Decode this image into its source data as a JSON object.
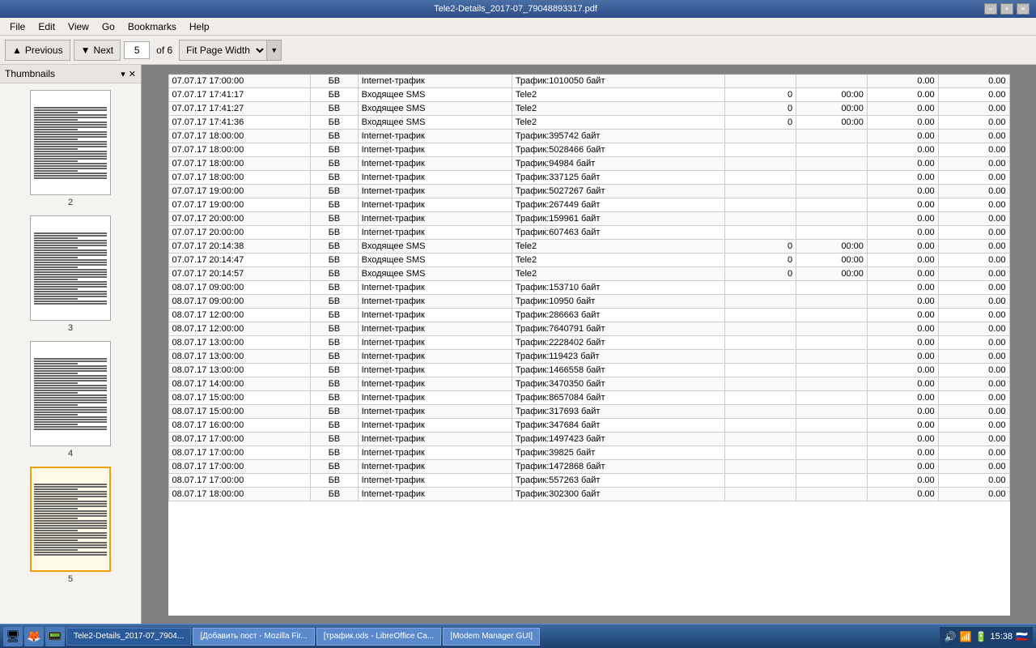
{
  "titlebar": {
    "title": "Tele2-Details_2017-07_79048893317.pdf",
    "min": "−",
    "max": "+",
    "close": "×"
  },
  "menubar": {
    "items": [
      "File",
      "Edit",
      "View",
      "Go",
      "Bookmarks",
      "Help"
    ]
  },
  "toolbar": {
    "previous_label": "Previous",
    "next_label": "Next",
    "current_page": "5",
    "total_pages": "of 6",
    "fit_option": "Fit Page Width"
  },
  "sidebar": {
    "title": "Thumbnails",
    "pages": [
      2,
      3,
      4,
      5
    ]
  },
  "table": {
    "rows": [
      [
        "07.07.17 17:41:17",
        "БВ",
        "Входящее SMS",
        "Tele2",
        "0",
        "00:00",
        "0.00",
        "0.00"
      ],
      [
        "07.07.17 17:41:27",
        "БВ",
        "Входящее SMS",
        "Tele2",
        "0",
        "00:00",
        "0.00",
        "0.00"
      ],
      [
        "07.07.17 17:41:36",
        "БВ",
        "Входящее SMS",
        "Tele2",
        "0",
        "00:00",
        "0.00",
        "0.00"
      ],
      [
        "07.07.17 18:00:00",
        "БВ",
        "Internet-трафик",
        "Трафик:395742 байт",
        "",
        "",
        "0.00",
        "0.00"
      ],
      [
        "07.07.17 18:00:00",
        "БВ",
        "Internet-трафик",
        "Трафик:5028466 байт",
        "",
        "",
        "0.00",
        "0.00"
      ],
      [
        "07.07.17 18:00:00",
        "БВ",
        "Internet-трафик",
        "Трафик:94984 байт",
        "",
        "",
        "0.00",
        "0.00"
      ],
      [
        "07.07.17 18:00:00",
        "БВ",
        "Internet-трафик",
        "Трафик:337125 байт",
        "",
        "",
        "0.00",
        "0.00"
      ],
      [
        "07.07.17 19:00:00",
        "БВ",
        "Internet-трафик",
        "Трафик:5027267 байт",
        "",
        "",
        "0.00",
        "0.00"
      ],
      [
        "07.07.17 19:00:00",
        "БВ",
        "Internet-трафик",
        "Трафик:267449 байт",
        "",
        "",
        "0.00",
        "0.00"
      ],
      [
        "07.07.17 20:00:00",
        "БВ",
        "Internet-трафик",
        "Трафик:159961 байт",
        "",
        "",
        "0.00",
        "0.00"
      ],
      [
        "07.07.17 20:00:00",
        "БВ",
        "Internet-трафик",
        "Трафик:607463 байт",
        "",
        "",
        "0.00",
        "0.00"
      ],
      [
        "07.07.17 20:14:38",
        "БВ",
        "Входящее SMS",
        "Tele2",
        "0",
        "00:00",
        "0.00",
        "0.00"
      ],
      [
        "07.07.17 20:14:47",
        "БВ",
        "Входящее SMS",
        "Tele2",
        "0",
        "00:00",
        "0.00",
        "0.00"
      ],
      [
        "07.07.17 20:14:57",
        "БВ",
        "Входящее SMS",
        "Tele2",
        "0",
        "00:00",
        "0.00",
        "0.00"
      ],
      [
        "08.07.17 09:00:00",
        "БВ",
        "Internet-трафик",
        "Трафик:153710 байт",
        "",
        "",
        "0.00",
        "0.00"
      ],
      [
        "08.07.17 09:00:00",
        "БВ",
        "Internet-трафик",
        "Трафик:10950 байт",
        "",
        "",
        "0.00",
        "0.00"
      ],
      [
        "08.07.17 12:00:00",
        "БВ",
        "Internet-трафик",
        "Трафик:286663 байт",
        "",
        "",
        "0.00",
        "0.00"
      ],
      [
        "08.07.17 12:00:00",
        "БВ",
        "Internet-трафик",
        "Трафик:7640791 байт",
        "",
        "",
        "0.00",
        "0.00"
      ],
      [
        "08.07.17 13:00:00",
        "БВ",
        "Internet-трафик",
        "Трафик:2228402 байт",
        "",
        "",
        "0.00",
        "0.00"
      ],
      [
        "08.07.17 13:00:00",
        "БВ",
        "Internet-трафик",
        "Трафик:119423 байт",
        "",
        "",
        "0.00",
        "0.00"
      ],
      [
        "08.07.17 13:00:00",
        "БВ",
        "Internet-трафик",
        "Трафик:1466558 байт",
        "",
        "",
        "0.00",
        "0.00"
      ],
      [
        "08.07.17 14:00:00",
        "БВ",
        "Internet-трафик",
        "Трафик:3470350 байт",
        "",
        "",
        "0.00",
        "0.00"
      ],
      [
        "08.07.17 15:00:00",
        "БВ",
        "Internet-трафик",
        "Трафик:8657084 байт",
        "",
        "",
        "0.00",
        "0.00"
      ],
      [
        "08.07.17 15:00:00",
        "БВ",
        "Internet-трафик",
        "Трафик:317693 байт",
        "",
        "",
        "0.00",
        "0.00"
      ],
      [
        "08.07.17 16:00:00",
        "БВ",
        "Internet-трафик",
        "Трафик:347684 байт",
        "",
        "",
        "0.00",
        "0.00"
      ],
      [
        "08.07.17 17:00:00",
        "БВ",
        "Internet-трафик",
        "Трафик:1497423 байт",
        "",
        "",
        "0.00",
        "0.00"
      ],
      [
        "08.07.17 17:00:00",
        "БВ",
        "Internet-трафик",
        "Трафик:39825 байт",
        "",
        "",
        "0.00",
        "0.00"
      ],
      [
        "08.07.17 17:00:00",
        "БВ",
        "Internet-трафик",
        "Трафик:1472868 байт",
        "",
        "",
        "0.00",
        "0.00"
      ],
      [
        "08.07.17 17:00:00",
        "БВ",
        "Internet-трафик",
        "Трафик:557263 байт",
        "",
        "",
        "0.00",
        "0.00"
      ],
      [
        "08.07.17 18:00:00",
        "БВ",
        "Internet-трафик",
        "Трафик:302300 байт",
        "",
        "",
        "0.00",
        "0.00"
      ]
    ],
    "clipped_row": [
      "07.07.17 17:00:00",
      "БВ",
      "Internet-трафик",
      "Трафик:1010050 байт",
      "",
      "",
      "0.00",
      "0.00"
    ]
  },
  "taskbar": {
    "icons": [
      "🖥",
      "🦊",
      "📟"
    ],
    "apps": [
      {
        "label": "Tele2-Details_2017-07_7904...",
        "active": true
      },
      {
        "label": "[Добавить пост - Mozilla Fir...",
        "active": false
      },
      {
        "label": "[трафик.ods - LibreOffice Ca...",
        "active": false
      },
      {
        "label": "[Modem Manager GUI]",
        "active": false
      }
    ],
    "tray_time": "15:38"
  }
}
